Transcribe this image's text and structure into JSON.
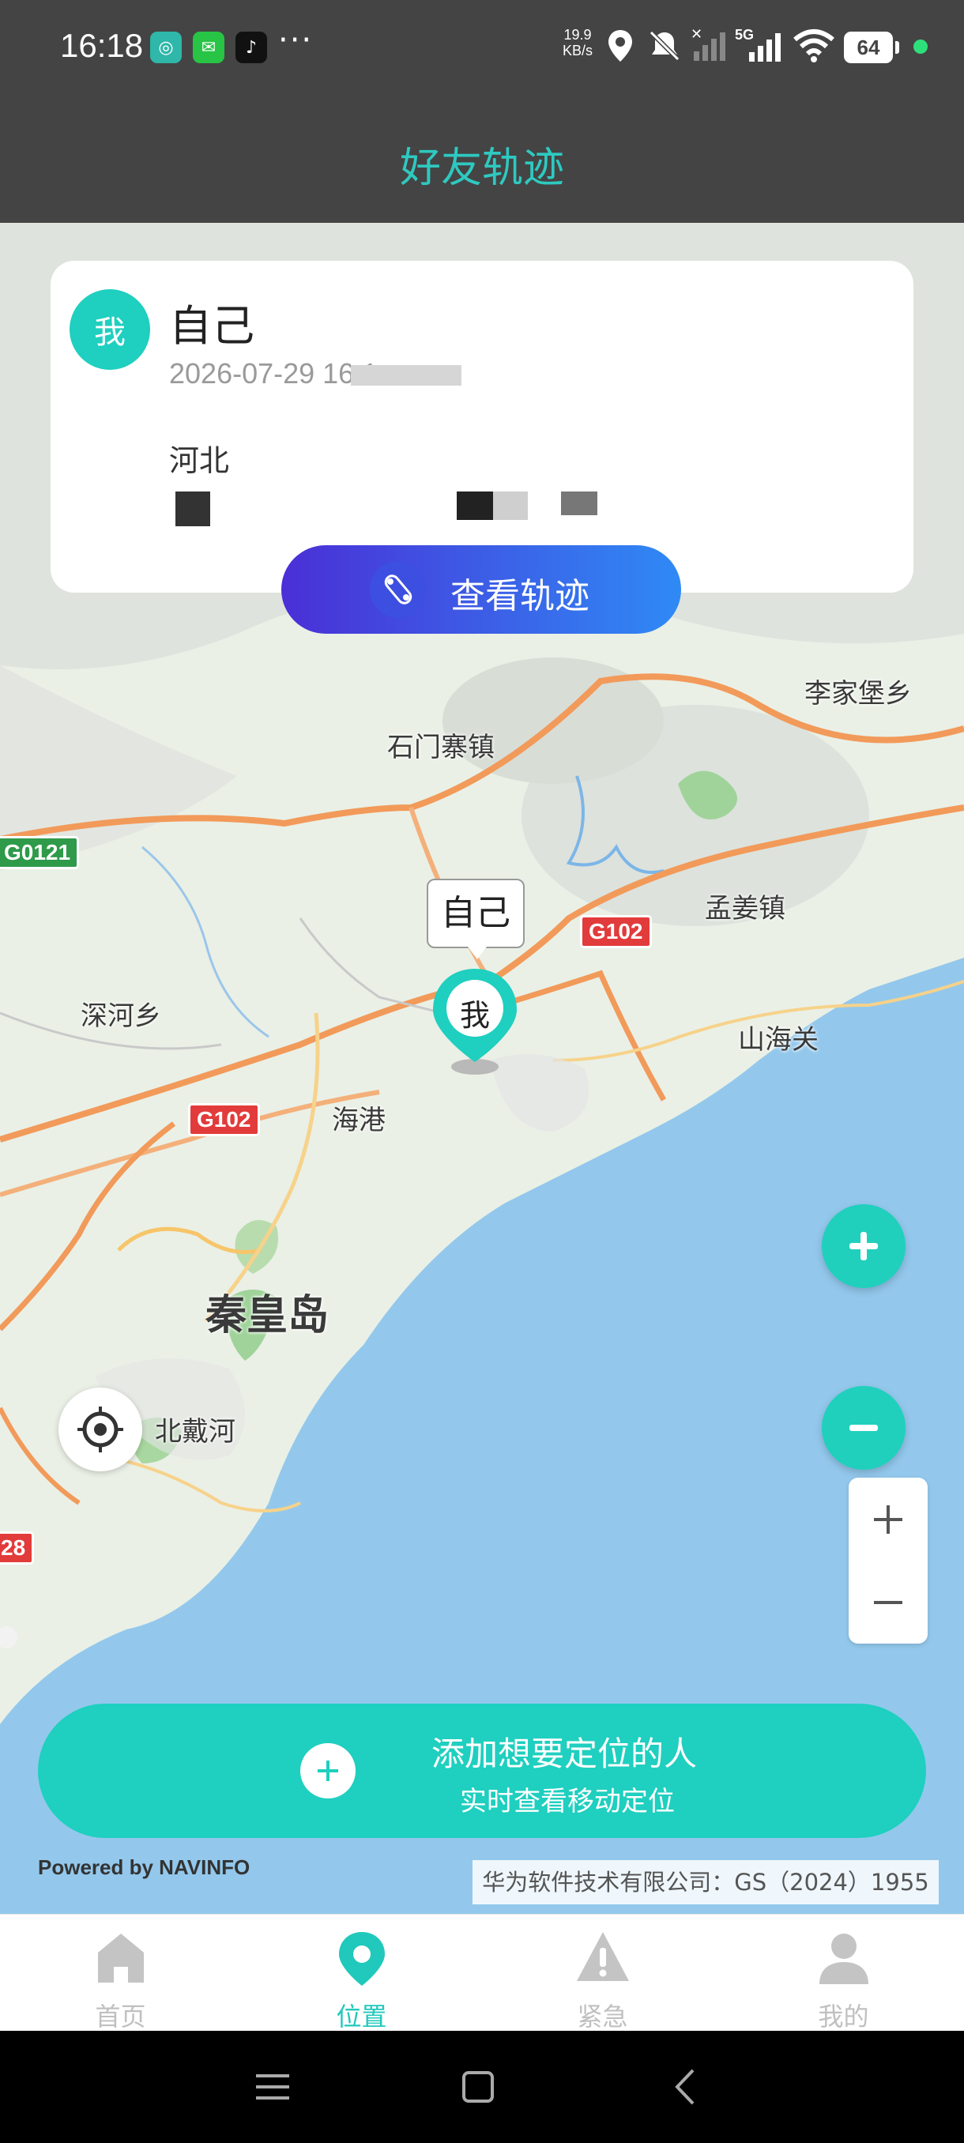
{
  "status_bar": {
    "time": "16:18",
    "speed_value": "19.9",
    "speed_unit": "KB/s",
    "network": "5G",
    "battery": "64",
    "more": "···"
  },
  "header": {
    "title": "好友轨迹"
  },
  "card": {
    "avatar_text": "我",
    "name": "自己",
    "time": "2026-07-29 16:1",
    "address": "河北",
    "track_button": "查看轨迹"
  },
  "map": {
    "labels": {
      "lijiabao": "李家堡乡",
      "shimenzhai": "石门寨镇",
      "mengjiang": "孟姜镇",
      "shenhe": "深河乡",
      "shanhaiguan": "山海关",
      "haigang": "海港",
      "qinhuangdao": "秦皇岛",
      "beidaihe": "北戴河"
    },
    "shields": {
      "g0121": "G0121",
      "g102_a": "G102",
      "g102_b": "G102",
      "edge": "28"
    },
    "marker": {
      "callout": "自己",
      "pin_text": "我"
    },
    "powered_by": "Powered by NAVINFO",
    "copyright": "华为软件技术有限公司：GS（2024）1955号"
  },
  "add_person": {
    "title": "添加想要定位的人",
    "subtitle": "实时查看移动定位"
  },
  "bottom_nav": [
    {
      "label": "首页",
      "icon": "home-icon",
      "active": false
    },
    {
      "label": "位置",
      "icon": "location-pin-icon",
      "active": true
    },
    {
      "label": "紧急",
      "icon": "warning-icon",
      "active": false
    },
    {
      "label": "我的",
      "icon": "person-icon",
      "active": false
    }
  ],
  "colors": {
    "accent": "#1fcfbf",
    "title": "#2ec9c0",
    "header_bg": "#444444",
    "track_gradient_start": "#4a2fd6",
    "track_gradient_end": "#2f8af5",
    "sea": "#93c8ec",
    "road": "#f29a5a"
  }
}
